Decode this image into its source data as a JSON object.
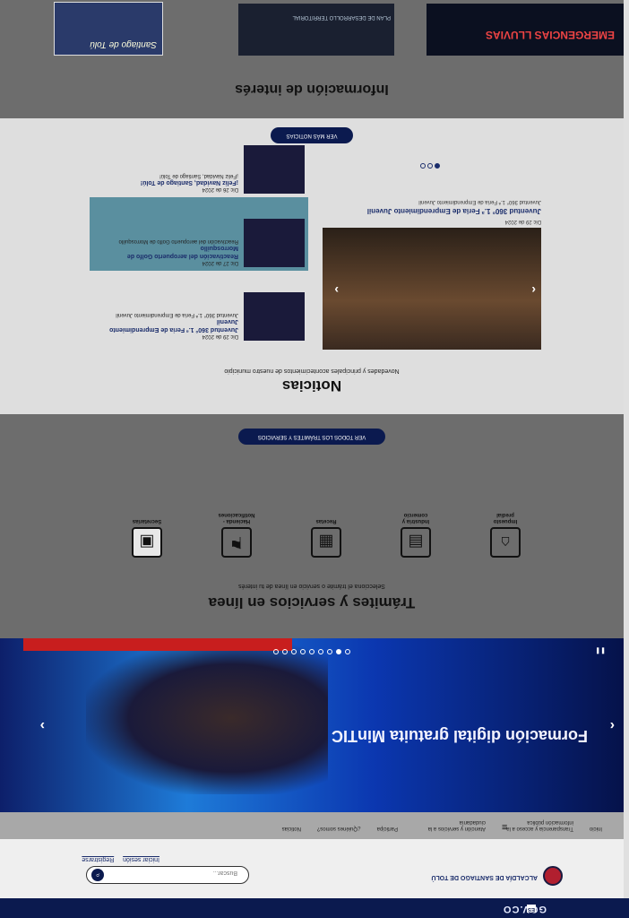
{
  "topbar": {
    "brand": "GOV.CO",
    "lang": "ES"
  },
  "header": {
    "logo_text": "ALCALDÍA DE SANTIAGO DE TOLÚ",
    "search_placeholder": "Buscar...",
    "login": "Iniciar sesión",
    "register": "Registrarse"
  },
  "nav": {
    "items": [
      "Inicio",
      "Transparencia y acceso a la información pública",
      "Atención y servicios a la ciudadanía",
      "Participa",
      "¿Quiénes somos?",
      "Noticias"
    ]
  },
  "hero": {
    "title": "Formación digital gratuita MinTIC",
    "slides_total": 9,
    "active_slide": 2
  },
  "tramites": {
    "title": "Trámites y servicios en línea",
    "subtitle": "Selecciona el trámite o servicio en línea de tu interés",
    "tiles": [
      "Impuesto predial",
      "Industria y comercio",
      "Recetas",
      "Hacienda - Notificaciones",
      "Secretarías"
    ],
    "button": "VER TODOS LOS TRÁMITES Y SERVICIOS"
  },
  "noticias": {
    "title": "Noticias",
    "subtitle": "Novedades y principales acontecimientos de nuestro municipio",
    "main": {
      "date": "Dic 29 de 2024",
      "title": "Juventud 360° 1.ª Feria de Emprendimiento Juvenil",
      "desc": "Juventud 360° 1.ª Feria de Emprendimiento Juvenil"
    },
    "list": [
      {
        "date": "Dic 29 de 2024",
        "title": "Juventud 360° 1.ª Feria de Emprendimiento Juvenil",
        "desc": "Juventud 360° 1.ª Feria de Emprendimiento Juvenil"
      },
      {
        "date": "Dic 27 de 2024",
        "title": "Reactivación del aeropuerto Golfo de Morrosquillo",
        "desc": "Reactivación del aeropuerto Golfo de Morrosquillo"
      },
      {
        "date": "Dic 26 de 2024",
        "title": "¡Feliz Navidad, Santiago de Tolú!",
        "desc": "¡Feliz Navidad, Santiago de Tolú!"
      }
    ],
    "button": "VER MÁS NOTICIAS"
  },
  "info": {
    "title": "Información de interés",
    "banners": [
      "EMERGENCIAS LLUVIAS",
      "PLAN DE DESARROLLO TERRITORIAL",
      "Santiago de Tolú"
    ]
  }
}
